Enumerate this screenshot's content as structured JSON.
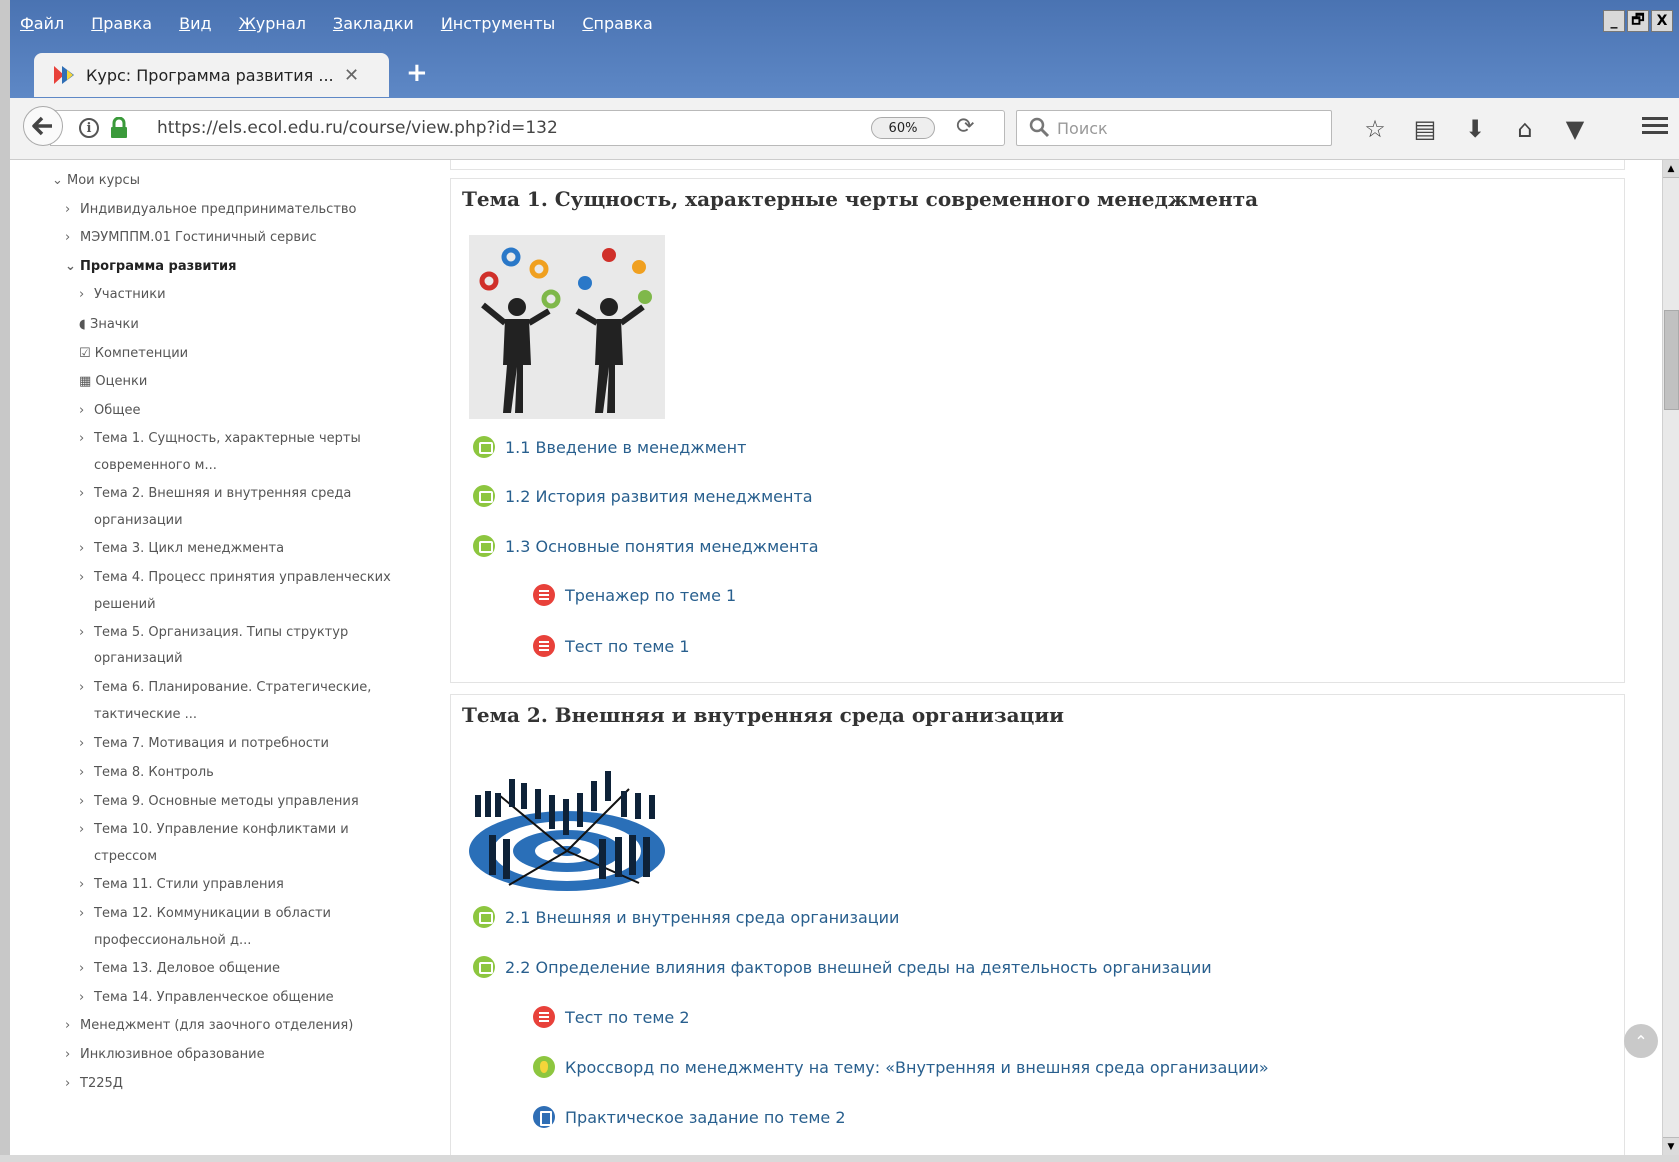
{
  "browser": {
    "menu": [
      "Файл",
      "Правка",
      "Вид",
      "Журнал",
      "Закладки",
      "Инструменты",
      "Справка"
    ],
    "window_controls": [
      "_",
      "🗗",
      "X"
    ],
    "tab_title": "Курс: Программа развития ...",
    "tab_close": "✕",
    "new_tab": "+",
    "url": "https://els.ecol.edu.ru/course/view.php?id=132",
    "info": "i",
    "zoom": "60%",
    "reload": "⟳",
    "search_placeholder": "Поиск",
    "toolbar_icons": [
      "☆",
      "▤",
      "⬇",
      "⌂",
      "▼"
    ]
  },
  "sidebar": {
    "my_courses": "Мои курсы",
    "items": [
      "Индивидуальное предпринимательство",
      "МЭУМППМ.01 Гостиничный сервис",
      "Программа развития",
      "Участники",
      "Значки",
      "Компетенции",
      "Оценки",
      "Общее",
      "Тема 1. Сущность, характерные черты",
      "современного м...",
      "Тема 2. Внешняя и внутренняя среда",
      "организации",
      "Тема 3. Цикл менеджмента",
      "Тема 4. Процесс принятия управленческих",
      "решений",
      "Тема 5. Организация. Типы структур",
      "организаций",
      "Тема 6. Планирование. Стратегические,",
      "тактические ...",
      "Тема 7. Мотивация и потребности",
      "Тема 8. Контроль",
      "Тема 9. Основные методы управления",
      "Тема 10. Управление конфликтами и",
      "стрессом",
      "Тема 11. Стили управления",
      "Тема 12. Коммуникации в области",
      "профессиональной д...",
      "Тема 13. Деловое общение",
      "Тема 14. Управленческое общение",
      "Менеджмент (для заочного отделения)",
      "Инклюзивное образование",
      "Т225Д"
    ]
  },
  "sections": [
    {
      "title": "Тема 1. Сущность, характерные черты современного менеджмента",
      "activities": [
        "1.1 Введение в менеджмент",
        "1.2 История развития менеджмента",
        "1.3 Основные понятия менеджмента",
        "Тренажер по теме 1",
        "Тест по теме 1"
      ]
    },
    {
      "title": "Тема 2. Внешняя и внутренняя среда организации",
      "activities": [
        "2.1 Внешняя и внутренняя среда организации",
        "2.2 Определение влияния факторов внешней среды на деятельность организации",
        "Тест по теме 2",
        "Кроссворд по менеджменту на тему: «Внутренняя и внешняя среда организации»",
        "Практическое задание по теме 2"
      ]
    }
  ],
  "colors": {
    "chrome": "#5a84c4",
    "link": "#285f8e",
    "activity_green": "#8dc63f",
    "activity_red": "#e8413a",
    "activity_blue": "#2f6eb5"
  }
}
